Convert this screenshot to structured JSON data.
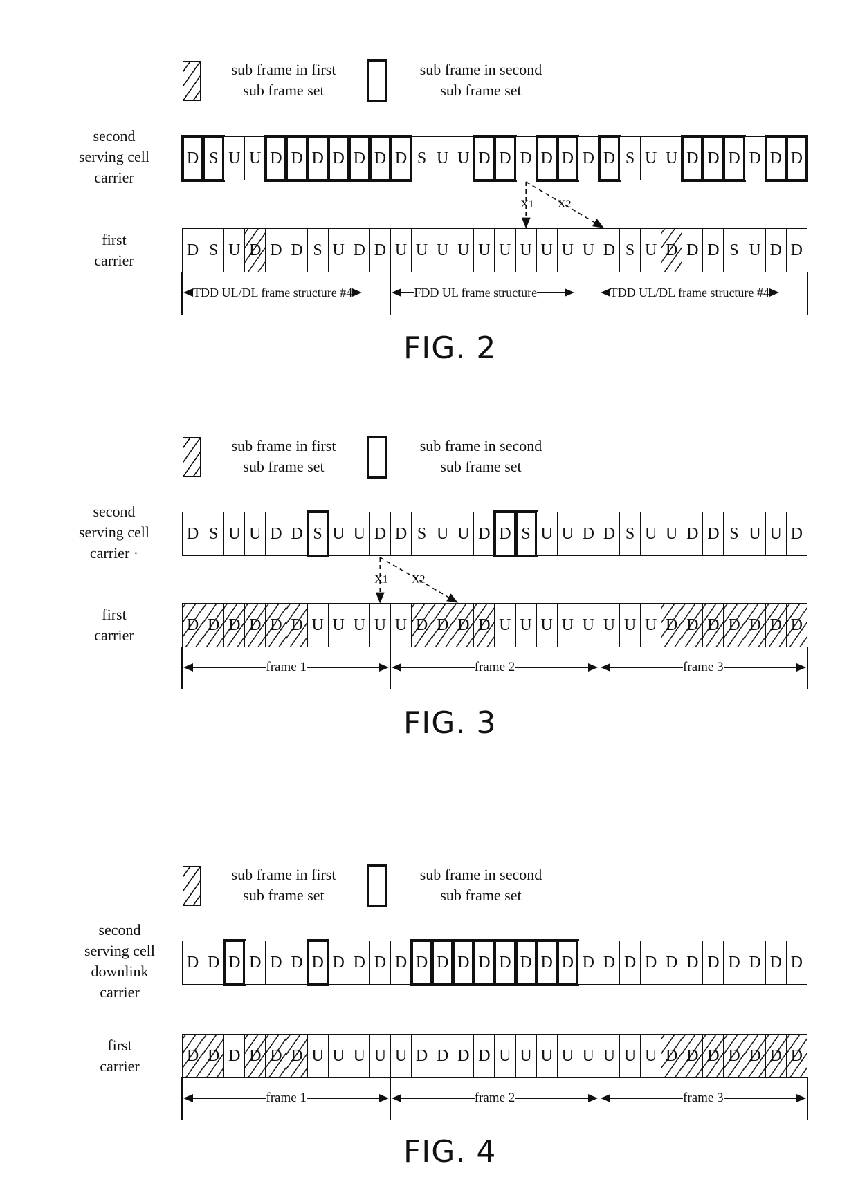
{
  "legend": {
    "first_set_line1": "sub frame in first",
    "first_set_line2": "sub frame set",
    "second_set_line1": "sub frame in second",
    "second_set_line2": "sub frame set"
  },
  "figures": [
    {
      "title": "FIG. 2",
      "second_row_label": [
        "second",
        "serving cell",
        "carrier"
      ],
      "first_row_label": [
        "first",
        "carrier"
      ],
      "second_row": {
        "letters": [
          "D",
          "S",
          "U",
          "U",
          "D",
          "D",
          "D",
          "D",
          "D",
          "D",
          "D",
          "S",
          "U",
          "U",
          "D",
          "D",
          "D",
          "D",
          "D",
          "D",
          "D",
          "S",
          "U",
          "U",
          "D",
          "D",
          "D",
          "D",
          "D",
          "D"
        ],
        "second_set": [
          0,
          1,
          4,
          5,
          6,
          7,
          8,
          9,
          10,
          14,
          15,
          17,
          18,
          20,
          24,
          25,
          26,
          28,
          29
        ],
        "first_set": []
      },
      "first_row": {
        "letters": [
          "D",
          "S",
          "U",
          "D",
          "D",
          "D",
          "S",
          "U",
          "D",
          "D",
          "U",
          "U",
          "U",
          "U",
          "U",
          "U",
          "U",
          "U",
          "U",
          "U",
          "D",
          "S",
          "U",
          "D",
          "D",
          "D",
          "S",
          "U",
          "D",
          "D"
        ],
        "first_set": [
          3,
          23
        ],
        "second_set": []
      },
      "sections": [
        {
          "label": "TDD UL/DL frame structure #4",
          "start": 0,
          "end": 10
        },
        {
          "label": "FDD UL frame structure",
          "start": 10,
          "end": 20
        },
        {
          "label": "TDD UL/DL frame structure #4",
          "start": 20,
          "end": 30
        }
      ],
      "arrows": [
        {
          "label": "X1",
          "from_index": 16,
          "to_index": 16
        },
        {
          "label": "X2",
          "from_index": 16,
          "to_index": 20
        }
      ]
    },
    {
      "title": "FIG. 3",
      "second_row_label": [
        "second",
        "serving cell",
        "carrier ·"
      ],
      "first_row_label": [
        "first",
        "carrier"
      ],
      "second_row": {
        "letters": [
          "D",
          "S",
          "U",
          "U",
          "D",
          "D",
          "S",
          "U",
          "U",
          "D",
          "D",
          "S",
          "U",
          "U",
          "D",
          "D",
          "S",
          "U",
          "U",
          "D",
          "D",
          "S",
          "U",
          "U",
          "D",
          "D",
          "S",
          "U",
          "U",
          "D"
        ],
        "second_set": [
          6,
          15,
          16
        ],
        "first_set": []
      },
      "first_row": {
        "letters": [
          "D",
          "D",
          "D",
          "D",
          "D",
          "D",
          "U",
          "U",
          "U",
          "U",
          "U",
          "D",
          "D",
          "D",
          "D",
          "U",
          "U",
          "U",
          "U",
          "U",
          "U",
          "U",
          "U",
          "D",
          "D",
          "D",
          "D",
          "D",
          "D",
          "D"
        ],
        "first_set": [
          0,
          1,
          2,
          3,
          4,
          5,
          11,
          12,
          13,
          14,
          23,
          24,
          25,
          26,
          27,
          28,
          29
        ],
        "second_set": []
      },
      "sections": [
        {
          "label": "frame 1",
          "start": 0,
          "end": 10
        },
        {
          "label": "frame 2",
          "start": 10,
          "end": 20
        },
        {
          "label": "frame 3",
          "start": 20,
          "end": 30
        }
      ],
      "arrows": [
        {
          "label": "X1",
          "from_index": 9,
          "to_index": 9
        },
        {
          "label": "X2",
          "from_index": 9,
          "to_index": 13
        }
      ]
    },
    {
      "title": "FIG. 4",
      "second_row_label": [
        "second",
        "serving cell",
        "downlink",
        "carrier"
      ],
      "first_row_label": [
        "first",
        "carrier"
      ],
      "second_row": {
        "letters": [
          "D",
          "D",
          "D",
          "D",
          "D",
          "D",
          "D",
          "D",
          "D",
          "D",
          "D",
          "D",
          "D",
          "D",
          "D",
          "D",
          "D",
          "D",
          "D",
          "D",
          "D",
          "D",
          "D",
          "D",
          "D",
          "D",
          "D",
          "D",
          "D",
          "D"
        ],
        "second_set": [
          2,
          6,
          11,
          12,
          13,
          14,
          15,
          16,
          17,
          18
        ],
        "first_set": []
      },
      "first_row": {
        "letters": [
          "D",
          "D",
          "D",
          "D",
          "D",
          "D",
          "U",
          "U",
          "U",
          "U",
          "U",
          "D",
          "D",
          "D",
          "D",
          "U",
          "U",
          "U",
          "U",
          "U",
          "U",
          "U",
          "U",
          "D",
          "D",
          "D",
          "D",
          "D",
          "D",
          "D"
        ],
        "first_set": [
          0,
          1,
          3,
          4,
          5,
          23,
          24,
          25,
          26,
          27,
          28,
          29
        ],
        "second_set": []
      },
      "sections": [
        {
          "label": "frame 1",
          "start": 0,
          "end": 10
        },
        {
          "label": "frame 2",
          "start": 10,
          "end": 20
        },
        {
          "label": "frame 3",
          "start": 20,
          "end": 30
        }
      ],
      "arrows": []
    }
  ]
}
